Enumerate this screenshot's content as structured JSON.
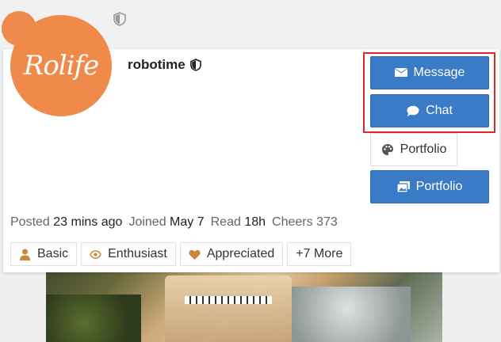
{
  "user": {
    "name": "robotime",
    "avatar_text": "Rolife"
  },
  "actions": {
    "message_label": "Message",
    "chat_label": "Chat",
    "portfolio_plain_label": "Portfolio",
    "portfolio_button_label": "Portfolio"
  },
  "stats": {
    "posted_label": "Posted",
    "posted_value": "23 mins ago",
    "joined_label": "Joined",
    "joined_value": "May 7",
    "read_label": "Read",
    "read_value": "18h",
    "cheers_label": "Cheers",
    "cheers_value": "373"
  },
  "badges": [
    {
      "label": "Basic",
      "icon": "user-icon"
    },
    {
      "label": "Enthusiast",
      "icon": "eye-icon"
    },
    {
      "label": "Appreciated",
      "icon": "heart-icon"
    },
    {
      "label": "+7 More",
      "icon": ""
    }
  ],
  "colors": {
    "accent": "#3a7bc8",
    "brand": "#f08a4b",
    "highlight": "#e0262b",
    "badge_icon": "#c8873a"
  }
}
